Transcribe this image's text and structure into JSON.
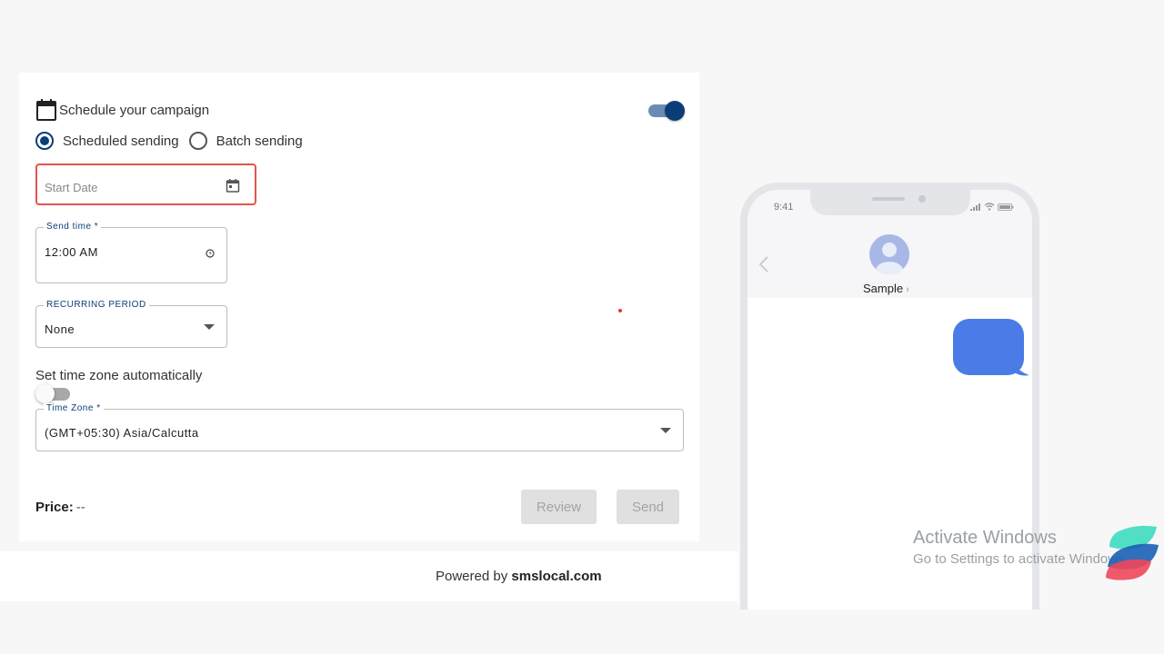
{
  "schedule": {
    "title": "Schedule your campaign",
    "enabled": true,
    "options": [
      {
        "label": "Scheduled sending",
        "checked": true
      },
      {
        "label": "Batch sending",
        "checked": false
      }
    ]
  },
  "start_date": {
    "placeholder": "Start Date",
    "icon": "calendar-icon"
  },
  "send_time": {
    "label": "Send time *",
    "value": "12:00 AM",
    "icon": "clock-icon"
  },
  "recurring": {
    "label": "RECURRING PERIOD",
    "value": "None"
  },
  "timezone_auto": {
    "label": "Set time zone automatically",
    "enabled": false
  },
  "timezone": {
    "label": "Time Zone *",
    "value": "(GMT+05:30) Asia/Calcutta"
  },
  "price": {
    "label": "Price:",
    "value": "--"
  },
  "buttons": {
    "review": "Review",
    "send": "Send"
  },
  "footer": {
    "prefix": "Powered by",
    "brand": "smslocal.com"
  },
  "phone": {
    "time": "9:41",
    "contact": "Sample",
    "chevron": "›"
  },
  "watermark": {
    "title": "Activate Windows",
    "subtitle": "Go to Settings to activate Windows."
  },
  "colors": {
    "accent": "#0b3d77",
    "error": "#e5534b",
    "bubble": "#4a7be7",
    "disabled_bg": "#e0e0e0"
  }
}
